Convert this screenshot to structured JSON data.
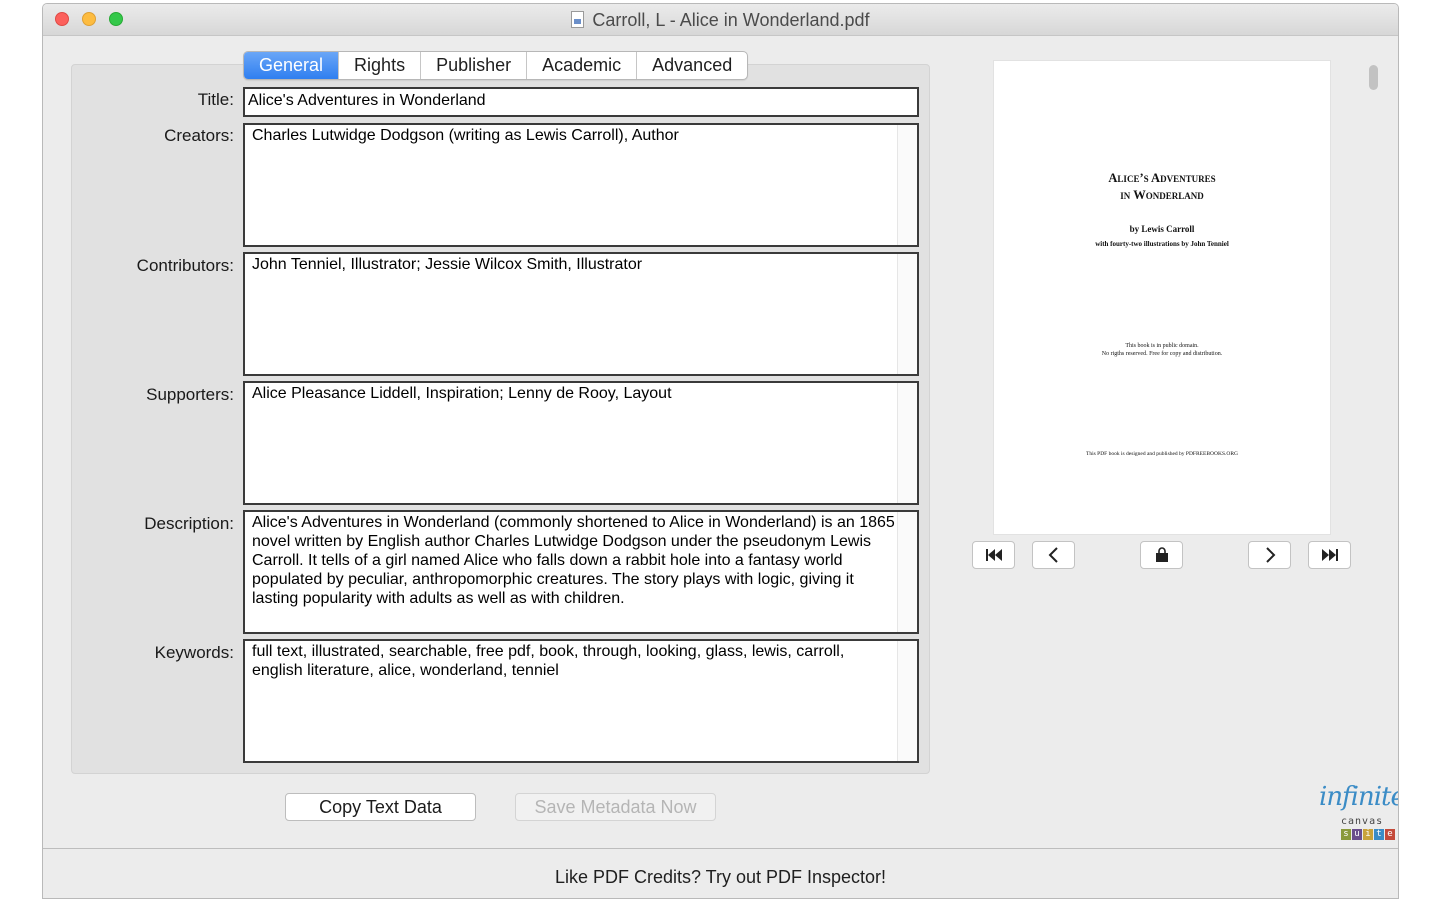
{
  "window": {
    "title": "Carroll, L - Alice in Wonderland.pdf"
  },
  "tabs": [
    {
      "label": "General",
      "active": true
    },
    {
      "label": "Rights",
      "active": false
    },
    {
      "label": "Publisher",
      "active": false
    },
    {
      "label": "Academic",
      "active": false
    },
    {
      "label": "Advanced",
      "active": false
    }
  ],
  "fields": {
    "title": {
      "label": "Title:",
      "value": "Alice's Adventures in Wonderland"
    },
    "creators": {
      "label": "Creators:",
      "value": "Charles Lutwidge Dodgson (writing as Lewis Carroll), Author"
    },
    "contributors": {
      "label": "Contributors:",
      "value": "John Tenniel, Illustrator; Jessie Wilcox Smith, Illustrator"
    },
    "supporters": {
      "label": "Supporters:",
      "value": "Alice Pleasance Liddell, Inspiration; Lenny de Rooy, Layout"
    },
    "description": {
      "label": "Description:",
      "value": "Alice's Adventures in Wonderland (commonly shortened to Alice in Wonderland) is an 1865 novel written by English author Charles Lutwidge Dodgson under the pseudonym Lewis Carroll. It tells of a girl named Alice who falls down a rabbit hole into a fantasy world populated by peculiar, anthropomorphic creatures. The story plays with logic, giving it lasting popularity with adults as well as with children."
    },
    "keywords": {
      "label": "Keywords:",
      "value": "full text, illustrated, searchable, free pdf, book, through, looking, glass, lewis, carroll, english literature, alice, wonderland, tenniel"
    }
  },
  "buttons": {
    "copy": "Copy Text Data",
    "save": "Save Metadata Now"
  },
  "preview": {
    "title_line1": "Alice’s Adventures",
    "title_line2": "in Wonderland",
    "by": "by Lewis Carroll",
    "with": "with fourty-two illustrations by John Tenniel",
    "pd_line1": "This book is in public domain.",
    "pd_line2": "No rigths reserved. Free for copy and distribution.",
    "publisher": "This PDF book is designed and published by PDFREEBOOKS.ORG"
  },
  "logo": {
    "word": "infinite",
    "canvas": "canvas",
    "suite": [
      "s",
      "u",
      "i",
      "t",
      "e"
    ]
  },
  "footer": {
    "text": "Like PDF Credits? Try out PDF Inspector!"
  },
  "colors": {
    "accent": "#2f7ff0",
    "close": "#fc605c",
    "minimize": "#fdbc40",
    "maximize": "#34c84a"
  }
}
